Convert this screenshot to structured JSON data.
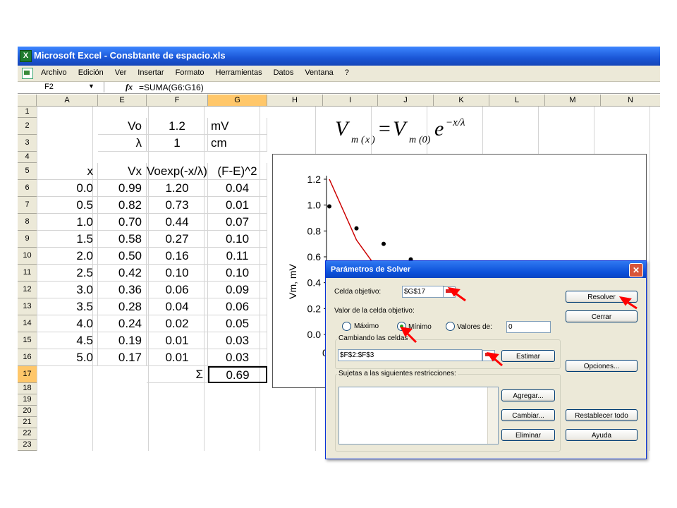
{
  "window": {
    "title": "Microsoft Excel - Consbtante de espacio.xls",
    "app_icon": "excel-icon"
  },
  "menu": [
    "Archivo",
    "Edición",
    "Ver",
    "Insertar",
    "Formato",
    "Herramientas",
    "Datos",
    "Ventana",
    "?"
  ],
  "formula_bar": {
    "name_box": "F2",
    "fx": "fx",
    "formula": "=SUMA(G6:G16)"
  },
  "columns": [
    "A",
    "E",
    "F",
    "G",
    "H",
    "I",
    "J",
    "K",
    "L",
    "M",
    "N"
  ],
  "selected_column": "G",
  "rows": [
    "1",
    "2",
    "3",
    "4",
    "5",
    "6",
    "7",
    "8",
    "9",
    "10",
    "11",
    "12",
    "13",
    "14",
    "15",
    "16",
    "17",
    "18",
    "19",
    "20",
    "21",
    "22",
    "23"
  ],
  "selected_row": "17",
  "params": {
    "r2": {
      "e": "Vo",
      "f": "1.2",
      "g": "mV"
    },
    "r3": {
      "e": "λ",
      "f": "1",
      "g": "cm"
    }
  },
  "headers": {
    "a": "x",
    "e": "Vx",
    "f": "Voexp(-x/λ)",
    "g": "(F-E)^2"
  },
  "table": [
    [
      "0.0",
      "0.99",
      "1.20",
      "0.04"
    ],
    [
      "0.5",
      "0.82",
      "0.73",
      "0.01"
    ],
    [
      "1.0",
      "0.70",
      "0.44",
      "0.07"
    ],
    [
      "1.5",
      "0.58",
      "0.27",
      "0.10"
    ],
    [
      "2.0",
      "0.50",
      "0.16",
      "0.11"
    ],
    [
      "2.5",
      "0.42",
      "0.10",
      "0.10"
    ],
    [
      "3.0",
      "0.36",
      "0.06",
      "0.09"
    ],
    [
      "3.5",
      "0.28",
      "0.04",
      "0.06"
    ],
    [
      "4.0",
      "0.24",
      "0.02",
      "0.05"
    ],
    [
      "4.5",
      "0.19",
      "0.01",
      "0.03"
    ],
    [
      "5.0",
      "0.17",
      "0.01",
      "0.03"
    ]
  ],
  "sum": {
    "symbol": "Σ",
    "value": "0.69"
  },
  "chart_data": {
    "type": "scatter",
    "ylabel": "Vm, mV",
    "ylim": [
      0,
      1.2
    ],
    "yticks": [
      "1.2",
      "1.0",
      "0.8",
      "0.6",
      "0.4",
      "0.2",
      "0.0"
    ],
    "xtick_visible": "0",
    "series": [
      {
        "kind": "points",
        "x": [
          0.0,
          0.5,
          1.0,
          1.5
        ],
        "y": [
          0.99,
          0.82,
          0.7,
          0.58
        ],
        "color": "#000000"
      },
      {
        "kind": "line",
        "x": [
          0.0,
          0.5,
          1.0,
          1.5
        ],
        "y": [
          1.2,
          0.73,
          0.44,
          0.27
        ],
        "color": "#cc0000"
      }
    ]
  },
  "dialog": {
    "title": "Parámetros de Solver",
    "target_label": "Celda objetivo:",
    "target_value": "$G$17",
    "value_label": "Valor de la celda objetivo:",
    "radio_max": "Máximo",
    "radio_min": "Mínimo",
    "radio_values": "Valores de:",
    "values_field": "0",
    "changing_label": "Cambiando las celdas",
    "changing_value": "$F$2:$F$3",
    "constraints_label": "Sujetas a las siguientes restricciones:",
    "btn_solve": "Resolver",
    "btn_close": "Cerrar",
    "btn_options": "Opciones...",
    "btn_guess": "Estimar",
    "btn_add": "Agregar...",
    "btn_change": "Cambiar...",
    "btn_delete": "Eliminar",
    "btn_reset": "Restablecer todo",
    "btn_help": "Ayuda"
  },
  "colors": {
    "accent_arrow": "#ff0000",
    "title_blue": "#1a56d6",
    "selection_orange": "#ffc76a"
  }
}
